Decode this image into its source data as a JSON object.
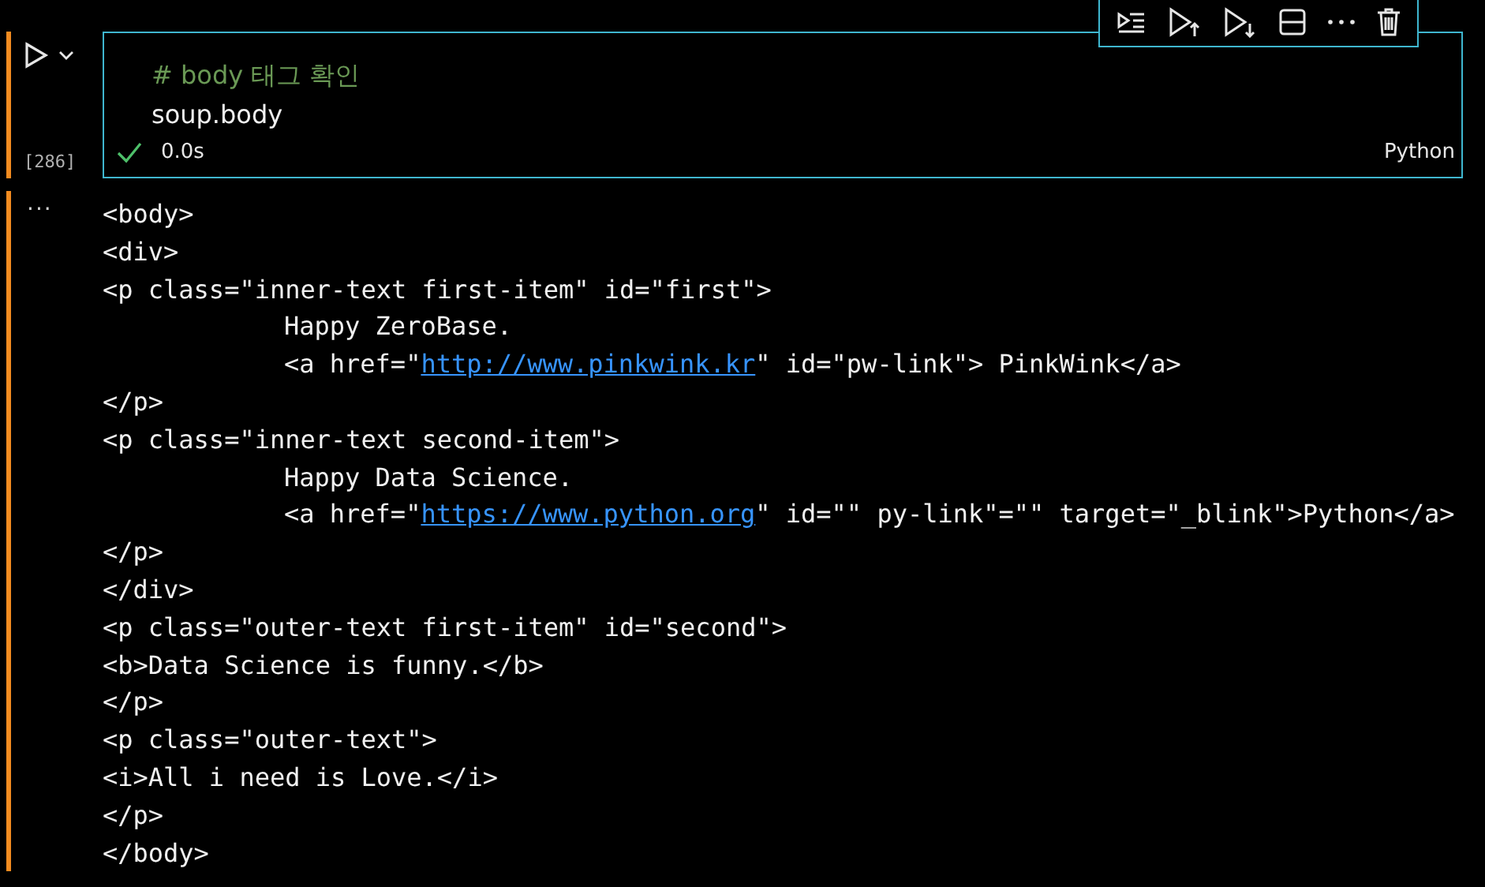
{
  "cell": {
    "exec_count": "[286]",
    "comment": "# body 태그 확인",
    "code": "soup.body",
    "status": "0.0s",
    "succeeded": true,
    "language": "Python"
  },
  "output": {
    "more": "···",
    "lines": [
      [
        {
          "kind": "text",
          "text": "<body>"
        }
      ],
      [
        {
          "kind": "text",
          "text": "<div>"
        }
      ],
      [
        {
          "kind": "text",
          "text": "<p class=\"inner-text first-item\" id=\"first\">"
        }
      ],
      [
        {
          "kind": "indent"
        },
        {
          "kind": "text",
          "text": "Happy ZeroBase."
        }
      ],
      [
        {
          "kind": "indent"
        },
        {
          "kind": "text",
          "text": "<a href=\""
        },
        {
          "kind": "link",
          "text": "http://www.pinkwink.kr"
        },
        {
          "kind": "text",
          "text": "\" id=\"pw-link\"> PinkWink</a>"
        }
      ],
      [
        {
          "kind": "text",
          "text": "</p>"
        }
      ],
      [
        {
          "kind": "text",
          "text": "<p class=\"inner-text second-item\">"
        }
      ],
      [
        {
          "kind": "indent"
        },
        {
          "kind": "text",
          "text": "Happy Data Science."
        }
      ],
      [
        {
          "kind": "indent"
        },
        {
          "kind": "text",
          "text": "<a href=\""
        },
        {
          "kind": "link",
          "text": "https://www.python.org"
        },
        {
          "kind": "text",
          "text": "\" id=\"\" py-link\"=\"\" target=\"_blink\">Python</a>"
        }
      ],
      [
        {
          "kind": "text",
          "text": "</p>"
        }
      ],
      [
        {
          "kind": "text",
          "text": "</div>"
        }
      ],
      [
        {
          "kind": "text",
          "text": "<p class=\"outer-text first-item\" id=\"second\">"
        }
      ],
      [
        {
          "kind": "text",
          "text": "<b>Data Science is funny.</b>"
        }
      ],
      [
        {
          "kind": "text",
          "text": "</p>"
        }
      ],
      [
        {
          "kind": "text",
          "text": "<p class=\"outer-text\">"
        }
      ],
      [
        {
          "kind": "text",
          "text": "<i>All i need is Love.</i>"
        }
      ],
      [
        {
          "kind": "text",
          "text": "</p>"
        }
      ],
      [
        {
          "kind": "text",
          "text": "</body>"
        }
      ]
    ]
  }
}
